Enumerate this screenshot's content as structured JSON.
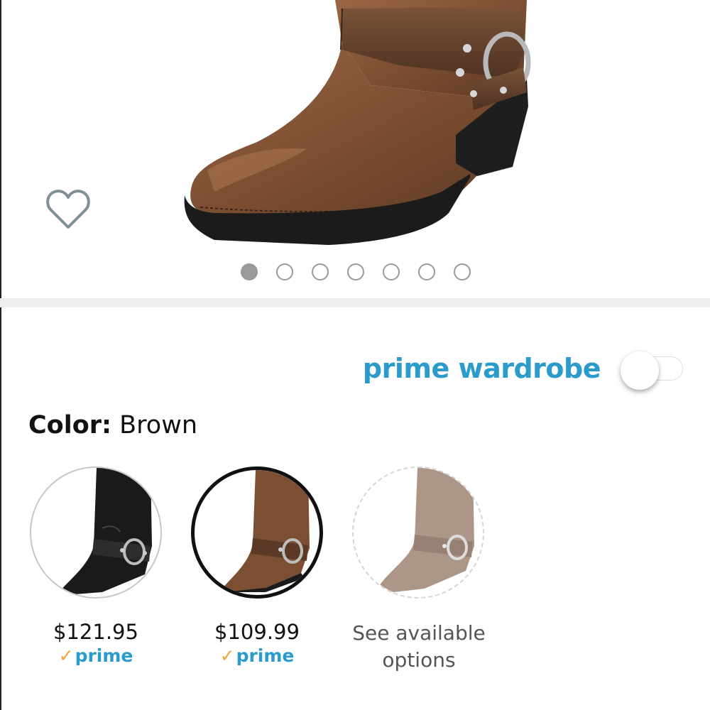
{
  "gallery": {
    "image_count": 7,
    "active_index": 0,
    "wishlist_icon": "heart-outline-icon"
  },
  "prime_wardrobe": {
    "label": "prime wardrobe",
    "toggle_on": false
  },
  "color": {
    "label": "Color:",
    "value": "Brown"
  },
  "swatches": [
    {
      "color": "Black",
      "price": "$121.95",
      "prime_check": "✓",
      "prime_label": "prime",
      "selected": false
    },
    {
      "color": "Brown",
      "price": "$109.99",
      "prime_check": "✓",
      "prime_label": "prime",
      "selected": true
    },
    {
      "color": "Tan",
      "text_line1": "See available",
      "text_line2": "options",
      "selected": false
    }
  ],
  "colors": {
    "accent_blue": "#2a9bcb",
    "prime_check": "#f3a33a",
    "boot_brown": "#8a5a3a",
    "boot_black": "#1a1a1a"
  }
}
